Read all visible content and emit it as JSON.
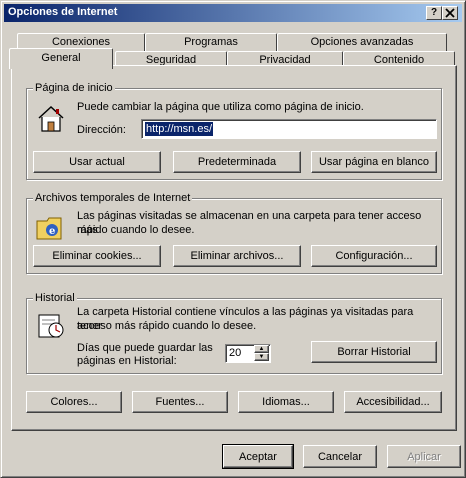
{
  "window": {
    "title": "Opciones de Internet",
    "help_label": "?",
    "close_label": "x"
  },
  "tabs": {
    "row1": [
      "Conexiones",
      "Programas",
      "Opciones avanzadas"
    ],
    "row2": [
      "General",
      "Seguridad",
      "Privacidad",
      "Contenido"
    ],
    "active": "General"
  },
  "home": {
    "legend": "Página de inicio",
    "description": "Puede cambiar la página que utiliza como página de inicio.",
    "address_label": "Dirección:",
    "address_value": "http://msn.es/",
    "btn_current": "Usar actual",
    "btn_default": "Predeterminada",
    "btn_blank": "Usar página en blanco"
  },
  "temp": {
    "legend": "Archivos temporales de Internet",
    "description_line1": "Las páginas visitadas se almacenan en una carpeta para tener acceso más",
    "description_line2": "rápido cuando lo desee.",
    "btn_cookies": "Eliminar cookies...",
    "btn_files": "Eliminar archivos...",
    "btn_settings": "Configuración..."
  },
  "history": {
    "legend": "Historial",
    "description_line1": "La carpeta Historial contiene vínculos a las páginas ya visitadas para tener",
    "description_line2": "acceso más rápido cuando lo desee.",
    "days_label_line1": "Días que puede guardar las",
    "days_label_line2": "páginas en Historial:",
    "days_value": "20",
    "btn_clear": "Borrar Historial"
  },
  "bottom_buttons": {
    "colors": "Colores...",
    "fonts": "Fuentes...",
    "languages": "Idiomas...",
    "accessibility": "Accesibilidad..."
  },
  "dialog_buttons": {
    "ok": "Aceptar",
    "cancel": "Cancelar",
    "apply": "Aplicar"
  }
}
